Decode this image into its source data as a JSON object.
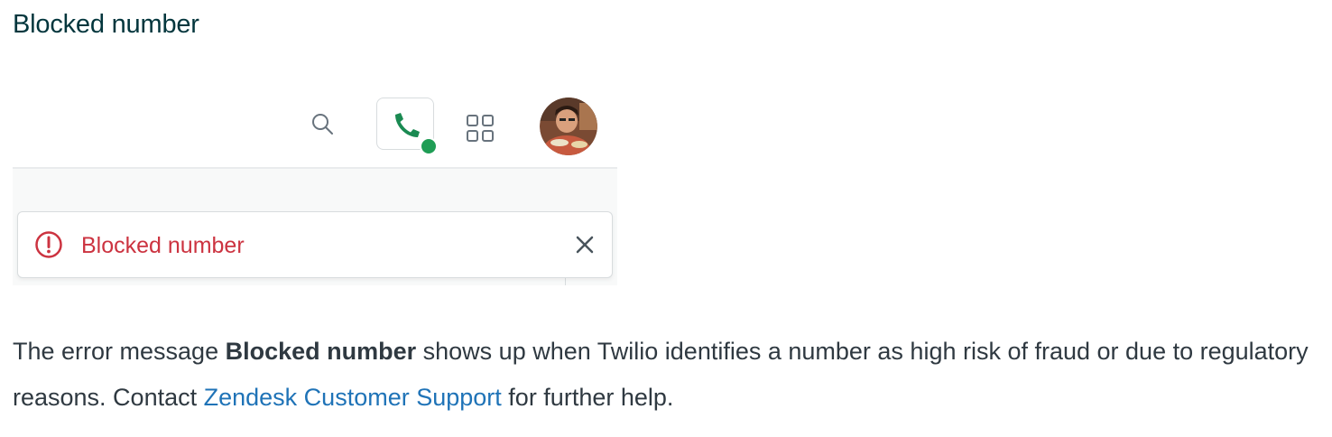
{
  "heading": "Blocked number",
  "topbar": {
    "search_icon": "search-icon",
    "phone_icon": "phone-icon",
    "status": "online",
    "apps_icon": "apps-grid-icon",
    "avatar_icon": "user-avatar"
  },
  "notification": {
    "icon": "alert-circle-icon",
    "message": "Blocked number",
    "close_icon": "close-icon"
  },
  "description": {
    "part1": "The error message ",
    "bold": "Blocked number",
    "part2": " shows up when Twilio identifies a number as high risk of fraud or due to regulatory reasons. Contact ",
    "link_text": "Zendesk Customer Support",
    "part3": " for further help."
  },
  "colors": {
    "heading": "#03363d",
    "error": "#cc3340",
    "link": "#1f73b7",
    "status_online": "#1f9d55",
    "phone_icon": "#1a8a52",
    "body_text": "#2f3941"
  }
}
